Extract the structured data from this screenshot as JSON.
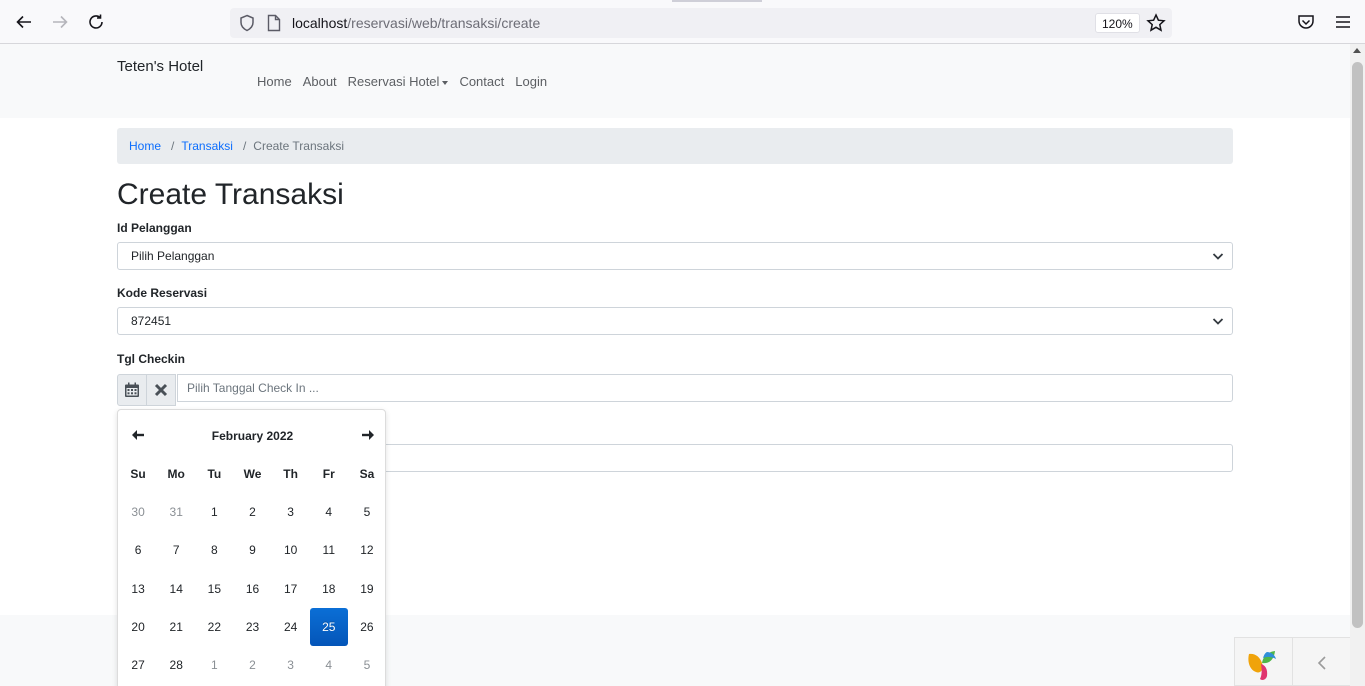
{
  "browser": {
    "url_host": "localhost",
    "url_path": "/reservasi/web/transaksi/create",
    "zoom": "120%"
  },
  "navbar": {
    "brand": "Teten's Hotel",
    "links": [
      "Home",
      "About",
      "Reservasi Hotel",
      "Contact",
      "Login"
    ]
  },
  "breadcrumb": {
    "home": "Home",
    "parent": "Transaksi",
    "current": "Create Transaksi",
    "separator": "/"
  },
  "page": {
    "title": "Create Transaksi"
  },
  "form": {
    "pelanggan_label": "Id Pelanggan",
    "pelanggan_value": "Pilih Pelanggan",
    "kode_label": "Kode Reservasi",
    "kode_value": "872451",
    "checkin_label": "Tgl Checkin",
    "checkin_placeholder": "Pilih Tanggal Check In ..."
  },
  "datepicker": {
    "month_label": "February 2022",
    "weekdays": [
      "Su",
      "Mo",
      "Tu",
      "We",
      "Th",
      "Fr",
      "Sa"
    ],
    "weeks": [
      [
        {
          "d": "30",
          "m": true
        },
        {
          "d": "31",
          "m": true
        },
        {
          "d": "1"
        },
        {
          "d": "2"
        },
        {
          "d": "3"
        },
        {
          "d": "4"
        },
        {
          "d": "5"
        }
      ],
      [
        {
          "d": "6"
        },
        {
          "d": "7"
        },
        {
          "d": "8"
        },
        {
          "d": "9"
        },
        {
          "d": "10"
        },
        {
          "d": "11"
        },
        {
          "d": "12"
        }
      ],
      [
        {
          "d": "13"
        },
        {
          "d": "14"
        },
        {
          "d": "15"
        },
        {
          "d": "16"
        },
        {
          "d": "17"
        },
        {
          "d": "18"
        },
        {
          "d": "19"
        }
      ],
      [
        {
          "d": "20"
        },
        {
          "d": "21"
        },
        {
          "d": "22"
        },
        {
          "d": "23"
        },
        {
          "d": "24"
        },
        {
          "d": "25",
          "a": true
        },
        {
          "d": "26"
        }
      ],
      [
        {
          "d": "27"
        },
        {
          "d": "28"
        },
        {
          "d": "1",
          "m": true
        },
        {
          "d": "2",
          "m": true
        },
        {
          "d": "3",
          "m": true
        },
        {
          "d": "4",
          "m": true
        },
        {
          "d": "5",
          "m": true
        }
      ]
    ]
  },
  "colors": {
    "link": "#0d6efd",
    "active_day": "#0455b8",
    "success": "#198754"
  }
}
